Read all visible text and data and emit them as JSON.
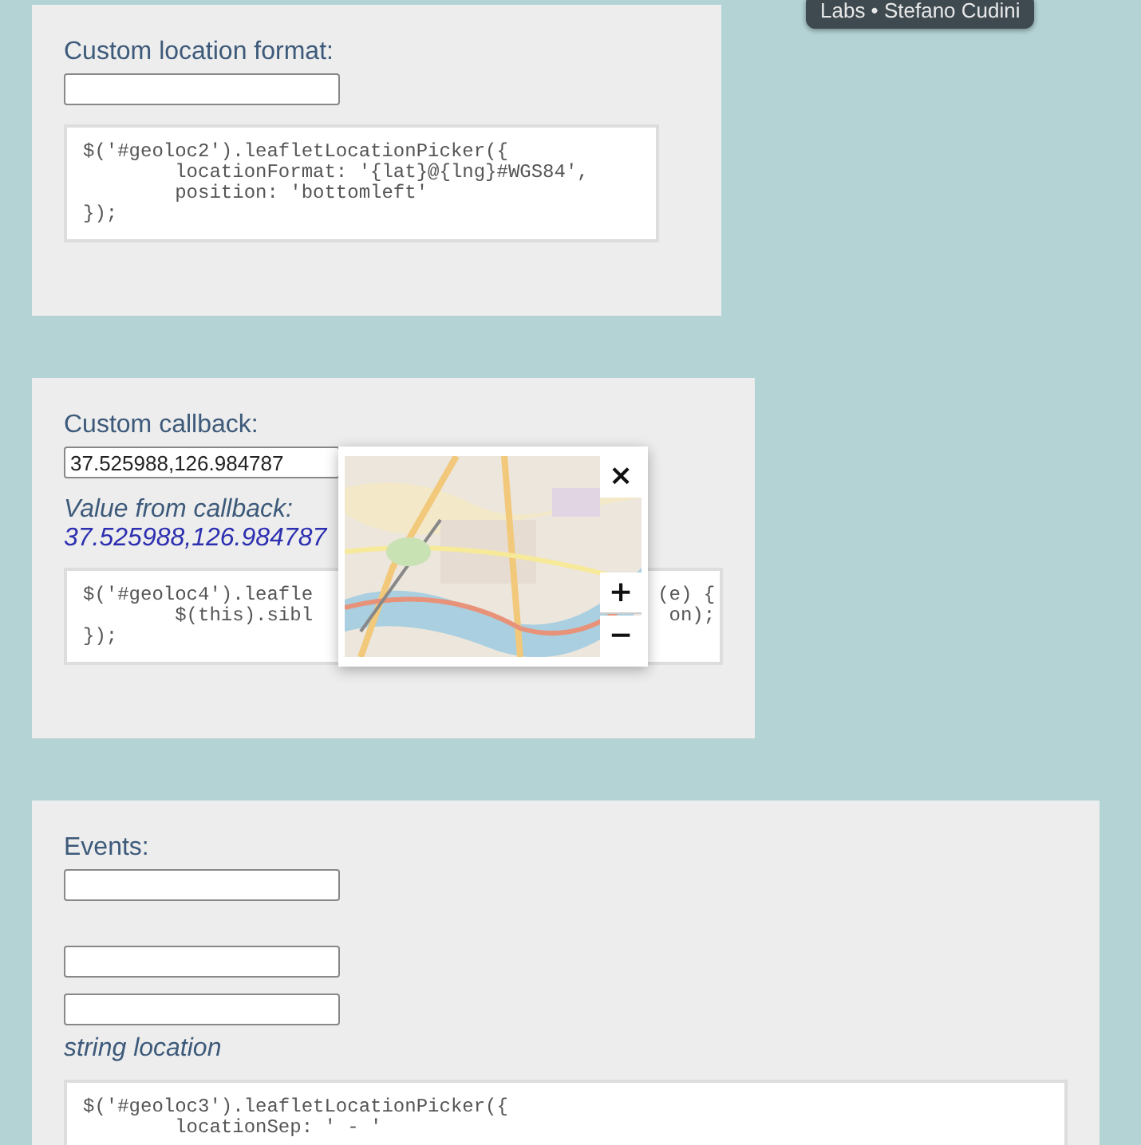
{
  "badge": {
    "text": "Labs • Stefano Cudini"
  },
  "panels": [
    {
      "label": "Custom location format:",
      "inputs": [
        {
          "kind": "text"
        }
      ],
      "code": [
        {
          "left": "$('#geoloc2').leafletLocationPicker({"
        },
        {
          "left": "        locationFormat: '{lat}@{lng}#WGS84',"
        },
        {
          "left": "        position: 'bottomleft'"
        },
        {
          "left": "});"
        }
      ]
    },
    {
      "label": "Custom callback:",
      "inputs": [
        {
          "kind": "text",
          "value": "37.525988,126.984787"
        }
      ],
      "result_label": "Value from callback:",
      "result_value": "37.525988,126.984787",
      "popup": {
        "close": "×",
        "zoom_in": "+",
        "zoom_out": "−"
      },
      "code": [
        {
          "left": "$('#geoloc4').leafle",
          "right": "(e) {"
        },
        {
          "left": "        $(this).sibl",
          "right": "on);"
        },
        {
          "left": "});"
        }
      ]
    },
    {
      "label": "Events:",
      "inputs": [
        {
          "kind": "text"
        },
        {
          "kind": "text"
        },
        {
          "kind": "text"
        }
      ],
      "note": "string location",
      "code": [
        {
          "left": "$('#geoloc3').leafletLocationPicker({"
        },
        {
          "left": "        locationSep: ' - '"
        }
      ]
    }
  ]
}
